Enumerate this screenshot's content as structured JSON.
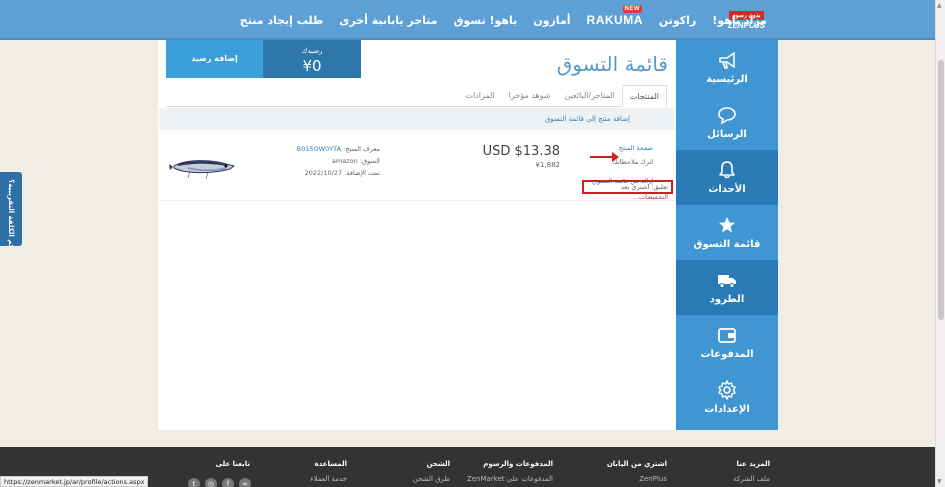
{
  "nav": {
    "items": [
      "طلب إيجاد منتج",
      "متاجر يابانية أخرى",
      "ياهو! تسوق",
      "أمازون",
      "RAKUMA",
      "راكوتن",
      "مزاد ياهو!"
    ],
    "rakuma_badge": "NEW",
    "logo_text": "ZENPLUS",
    "logo_tag": "بدون رسوم"
  },
  "sidebar": {
    "items": [
      {
        "label": "الرئيسية",
        "icon": "megaphone-icon"
      },
      {
        "label": "الرسائل",
        "icon": "chat-bubble-icon"
      },
      {
        "label": "الأحداث",
        "icon": "bell-icon"
      },
      {
        "label": "قائمة التسوق",
        "icon": "star-icon"
      },
      {
        "label": "الطرود",
        "icon": "truck-icon"
      },
      {
        "label": "المدفوعات",
        "icon": "wallet-icon"
      },
      {
        "label": "الإعدادات",
        "icon": "gear-icon"
      }
    ]
  },
  "page": {
    "title": "قائمة التسوق",
    "balance_label": "رصيدك",
    "balance_value": "¥0",
    "add_balance": "إضافة رصيد"
  },
  "tabs": [
    "المنتجات",
    "المتاجر/البائعين",
    "شوهد مؤخرا",
    "المزادات"
  ],
  "add_to_list": "إضافة منتج إلى قائمة التسوق",
  "item": {
    "product_page": "صفحة المنتج",
    "leave_note": "اترك ملاحظاتك",
    "remove": "إزالة من قائمة التسوق",
    "comment": "تعليق: اشتري بعد التخفيضات...",
    "price_usd": "USD $13.38",
    "price_jpy": "¥1,882",
    "product_id_label": "معرف المنتج:",
    "product_id": "B015OW0YTA",
    "market_label": "السوق:",
    "market": "amazon",
    "added_label": "تمت الإضافة:",
    "added_date": "2022/10/27"
  },
  "side_ad": "كم الكلفة التقريبية؟",
  "footer": {
    "cols": [
      {
        "heading": "المزيد عنا",
        "sub": "ملف الشركة"
      },
      {
        "heading": "اشتري من اليابان",
        "sub": "ZenPlus"
      },
      {
        "heading": "المدفوعات والرسوم",
        "sub": "المدفوعات على ZenMarket"
      },
      {
        "heading": "الشحن",
        "sub": "طرق الشحن"
      },
      {
        "heading": "المساعدة",
        "sub": "خدمة العملاء"
      },
      {
        "heading": "تابعنا على",
        "sub": ""
      }
    ],
    "status_url": "https://zenmarket.jp/ar/profile/actions.aspx"
  },
  "colors": {
    "nav_blue": "#5e9fd6",
    "sidebar_blue": "#3f96d2",
    "sidebar_active": "#2a7bb5",
    "highlight_red": "#d41d1d"
  }
}
